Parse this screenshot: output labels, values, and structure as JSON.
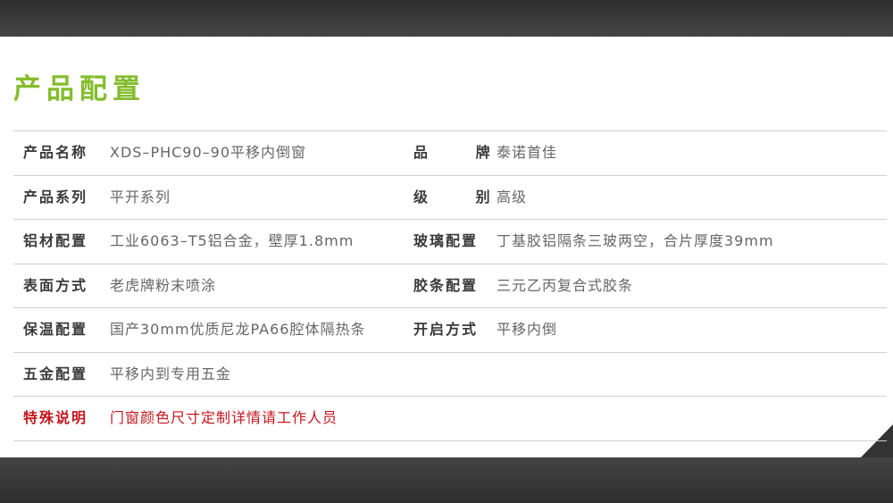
{
  "title": "产品配置",
  "rows": [
    {
      "l1": "产品名称",
      "v1": " XDS–PHC90–90平移内倒窗",
      "l2": "品  牌",
      "v2": "泰诺首佳"
    },
    {
      "l1": "产品系列",
      "v1": "平开系列",
      "l2": "级  别",
      "v2": "高级"
    },
    {
      "l1": "铝材配置",
      "v1": "工业6063–T5铝合金，壁厚1.8mm",
      "l2": "玻璃配置",
      "v2": "丁基胶铝隔条三玻两空，合片厚度39mm"
    },
    {
      "l1": "表面方式",
      "v1": "老虎牌粉末喷涂",
      "l2": "胶条配置",
      "v2": "三元乙丙复合式胶条"
    },
    {
      "l1": "保温配置",
      "v1": "国产30mm优质尼龙PA66腔体隔热条",
      "l2": "开启方式",
      "v2": "平移内倒"
    },
    {
      "l1": "五金配置",
      "v1": "平移内到专用五金"
    },
    {
      "l1": "特殊说明",
      "v1": "门窗颜色尺寸定制详情请工作人员"
    }
  ],
  "colors": {
    "title": "#84bd2c",
    "notice": "#c3161c"
  }
}
